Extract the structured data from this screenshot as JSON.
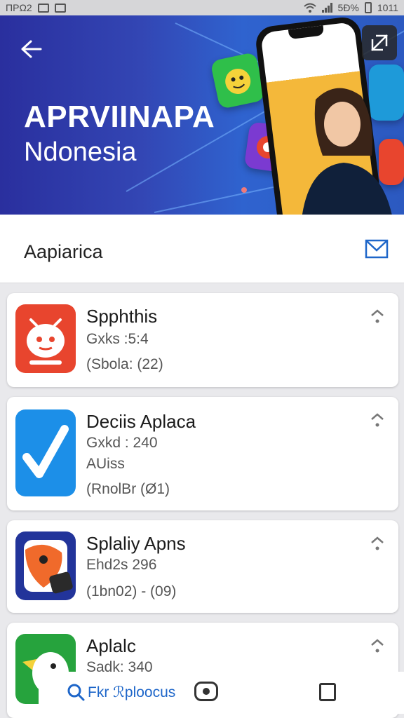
{
  "status": {
    "left": "ΠΡΩ2",
    "right": "5Ð%",
    "time": "1011"
  },
  "hero": {
    "title": "APRVIINAPA",
    "subtitle": "Ndonesia"
  },
  "section": {
    "title": "Aapiarica"
  },
  "apps": [
    {
      "name": "Spphthis",
      "lines": [
        "Gxks :5:4",
        "(Sbola: (22)"
      ],
      "icon": "red-robot-icon"
    },
    {
      "name": "Deciis Aplaca",
      "lines": [
        "Gxkd : 240",
        "AUiss",
        "(RnolBr (Ø1)"
      ],
      "icon": "blue-check-icon"
    },
    {
      "name": "Splaliy Apns",
      "lines": [
        "Ehd2s 296",
        "(1bn02) - (09)"
      ],
      "icon": "orange-mascot-icon"
    },
    {
      "name": "Aplalc",
      "lines": [
        "Sadk: 340"
      ],
      "icon": "green-bird-icon"
    }
  ],
  "bottom_bar": {
    "search_label": "Fkr ℛploocus"
  },
  "colors": {
    "hero_blue": "#2f4fc1",
    "accent_blue": "#1e66c9",
    "red": "#e8452e",
    "green": "#26a33d"
  }
}
